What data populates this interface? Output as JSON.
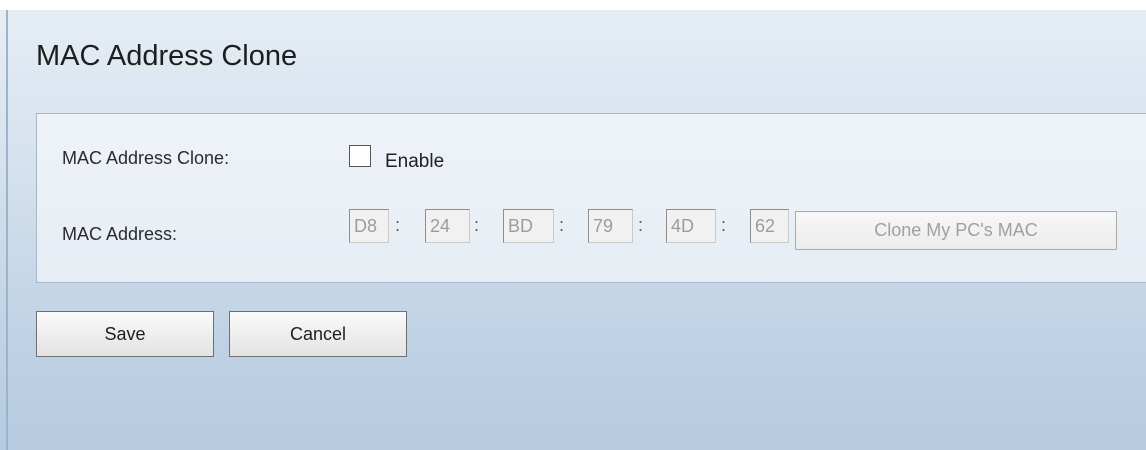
{
  "page": {
    "title": "MAC Address Clone"
  },
  "clone_setting": {
    "label": "MAC Address Clone:",
    "checkbox_label": "Enable",
    "checked": false
  },
  "mac_address": {
    "label": "MAC Address:",
    "octets": [
      "D8",
      "24",
      "BD",
      "79",
      "4D",
      "62"
    ],
    "separator": ":",
    "disabled": true,
    "clone_button_label": "Clone My PC's MAC"
  },
  "actions": {
    "save_label": "Save",
    "cancel_label": "Cancel"
  },
  "colors": {
    "background_top": "#e7eef5",
    "background_bottom": "#b6cbe0",
    "panel_border": "#a7b7c7",
    "disabled_text": "#9c9c9c"
  }
}
